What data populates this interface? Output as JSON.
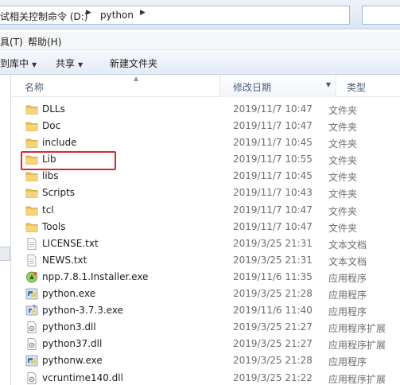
{
  "address": {
    "crumb_drive": "试相关控制命令 (D:)",
    "crumb_folder": "python"
  },
  "menu": {
    "items": [
      "具(T)",
      "帮助(H)"
    ]
  },
  "toolbar": {
    "include_label": "到库中",
    "share_label": "共享",
    "new_folder_label": "新建文件夹"
  },
  "columns": {
    "name": "名称",
    "date": "修改日期",
    "type": "类型"
  },
  "files": [
    {
      "name": "DLLs",
      "date": "2019/11/7 10:47",
      "type": "文件夹",
      "icon": "folder-icon"
    },
    {
      "name": "Doc",
      "date": "2019/11/7 10:47",
      "type": "文件夹",
      "icon": "folder-icon"
    },
    {
      "name": "include",
      "date": "2019/11/7 10:45",
      "type": "文件夹",
      "icon": "folder-icon"
    },
    {
      "name": "Lib",
      "date": "2019/11/7 10:55",
      "type": "文件夹",
      "icon": "folder-icon"
    },
    {
      "name": "libs",
      "date": "2019/11/7 10:45",
      "type": "文件夹",
      "icon": "folder-icon"
    },
    {
      "name": "Scripts",
      "date": "2019/11/7 10:43",
      "type": "文件夹",
      "icon": "folder-icon"
    },
    {
      "name": "tcl",
      "date": "2019/11/7 10:47",
      "type": "文件夹",
      "icon": "folder-icon"
    },
    {
      "name": "Tools",
      "date": "2019/11/7 10:47",
      "type": "文件夹",
      "icon": "folder-icon"
    },
    {
      "name": "LICENSE.txt",
      "date": "2019/3/25 21:31",
      "type": "文本文档",
      "icon": "text-file-icon"
    },
    {
      "name": "NEWS.txt",
      "date": "2019/3/25 21:31",
      "type": "文本文档",
      "icon": "text-file-icon"
    },
    {
      "name": "npp.7.8.1.Installer.exe",
      "date": "2019/11/6 11:35",
      "type": "应用程序",
      "icon": "installer-icon"
    },
    {
      "name": "python.exe",
      "date": "2019/3/25 21:28",
      "type": "应用程序",
      "icon": "python-icon"
    },
    {
      "name": "python-3.7.3.exe",
      "date": "2019/11/6 11:40",
      "type": "应用程序",
      "icon": "setup-icon"
    },
    {
      "name": "python3.dll",
      "date": "2019/3/25 21:27",
      "type": "应用程序扩展",
      "icon": "dll-file-icon"
    },
    {
      "name": "python37.dll",
      "date": "2019/3/25 21:27",
      "type": "应用程序扩展",
      "icon": "dll-file-icon"
    },
    {
      "name": "pythonw.exe",
      "date": "2019/3/25 21:28",
      "type": "应用程序",
      "icon": "python-icon"
    },
    {
      "name": "vcruntime140.dll",
      "date": "2019/3/25 21:22",
      "type": "应用程序扩展",
      "icon": "dll-file-icon"
    }
  ],
  "selected_file": "Lib",
  "colors": {
    "highlight": "#e0262d",
    "folder": "#e8c25a"
  }
}
